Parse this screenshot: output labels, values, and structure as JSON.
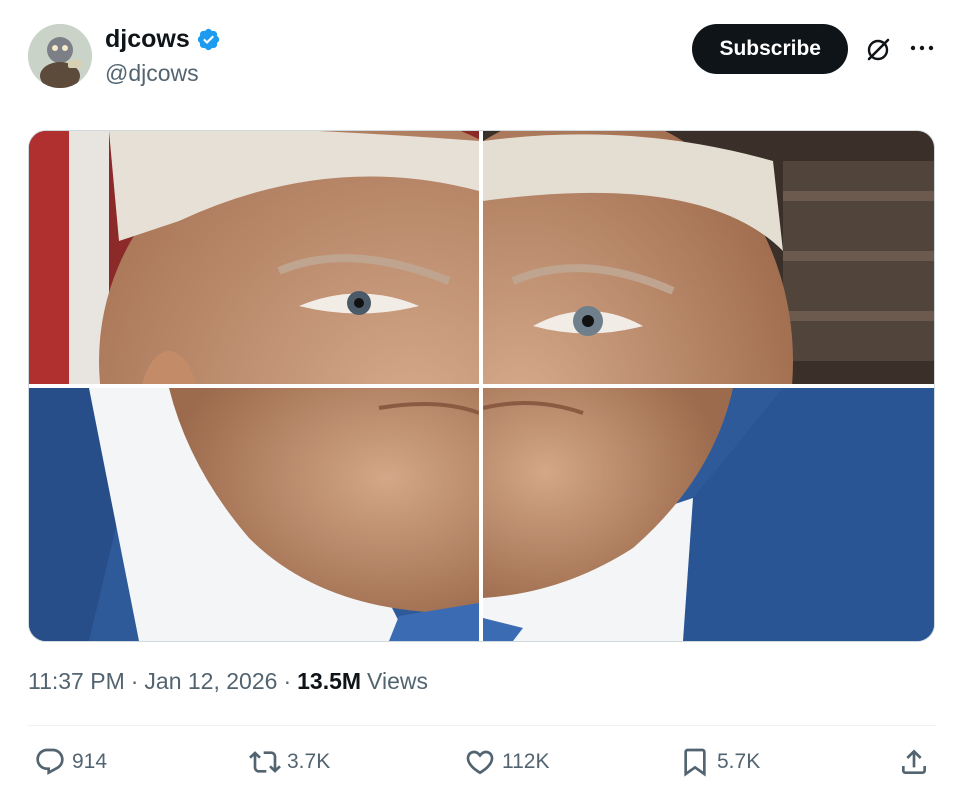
{
  "author": {
    "display_name": "djcows",
    "handle": "@djcows",
    "verified": true,
    "verified_color": "#1d9bf0"
  },
  "header": {
    "subscribe_label": "Subscribe",
    "icons": [
      "grok-icon",
      "more-icon"
    ]
  },
  "media": {
    "layout": "2x2-grid",
    "tile_count": 4
  },
  "meta": {
    "time": "11:37 PM",
    "separator": "·",
    "date": "Jan 12, 2026",
    "views_count": "13.5M",
    "views_label": "Views"
  },
  "actions": {
    "replies": "914",
    "reposts": "3.7K",
    "likes": "112K",
    "bookmarks": "5.7K",
    "icons": [
      "reply-icon",
      "repost-icon",
      "like-icon",
      "bookmark-icon",
      "share-icon"
    ]
  },
  "colors": {
    "text_primary": "#0f1419",
    "text_secondary": "#536471",
    "button_bg": "#0f1419",
    "divider": "#eff3f4"
  }
}
